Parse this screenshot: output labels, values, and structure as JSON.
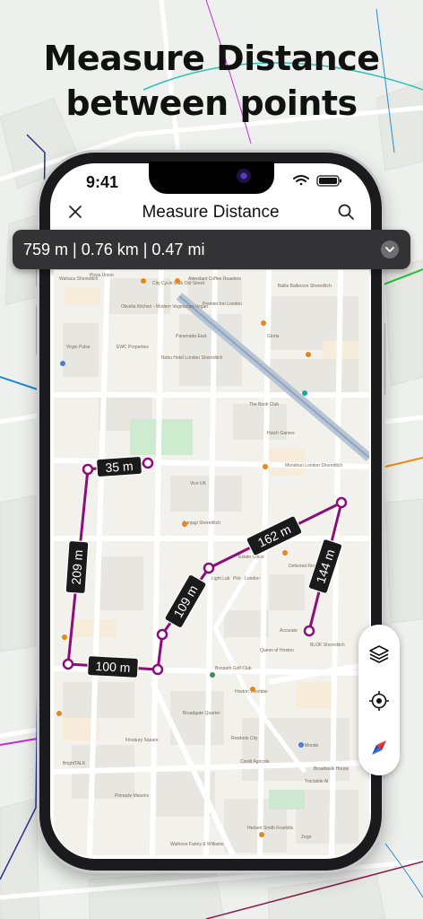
{
  "headline": {
    "line1": "Measure Distance",
    "line2": "between points"
  },
  "status_bar": {
    "time": "9:41"
  },
  "app_bar": {
    "title": "Measure Distance",
    "close_icon": "close-icon",
    "search_icon": "search-icon"
  },
  "distance_summary": {
    "text": "759 m |  0.76 km | 0.47 mi",
    "toggle_icon": "chevron-down-icon"
  },
  "segments": [
    {
      "label": "35 m"
    },
    {
      "label": "209 m"
    },
    {
      "label": "100 m"
    },
    {
      "label": "109 m"
    },
    {
      "label": "162 m"
    },
    {
      "label": "144 m"
    }
  ],
  "map_controls": [
    {
      "icon": "layers-icon"
    },
    {
      "icon": "my-location-icon"
    },
    {
      "icon": "compass-icon"
    }
  ],
  "map_labels": [
    "Wahaca Shoreditch",
    "Pizza Union",
    "Attendant Coffee Roasters",
    "City Cycle Club Old Street",
    "Olivelia Kitchen - Modern Vegetarian-Vegan",
    "Ballie Ballerson Shoreditch",
    "Premier Inn London",
    "EWC Properties",
    "Paramatta East",
    "Virgin Pulse",
    "Nobu Hotel London Shoreditch",
    "Gloria",
    "The Book Club",
    "Hutch Games",
    "Mondrian London Shoreditch",
    "Vice UK",
    "Sanjagi Shoreditch",
    "Estate Office",
    "Defected Records",
    "Light Lab",
    "Plot - London",
    "Queen of Hoxton",
    "Accurate",
    "BLOK Shoreditch",
    "Boxpark Golf Club",
    "Hoxton Trembler",
    "Broadgate Quarter",
    "Rowbots City",
    "Credit Agricole",
    "Mondo",
    "Broadwalk House",
    "Tractable AI",
    "BrightTALK",
    "Finsbury Square",
    "Pinnacle Masons",
    "Waitrose Farley & Williams",
    "Zego",
    "Herbert Smith Freehills"
  ],
  "colors": {
    "route": "#8b0f7a",
    "label_bg": "#1a1a1a",
    "bar_bg": "#333335"
  }
}
